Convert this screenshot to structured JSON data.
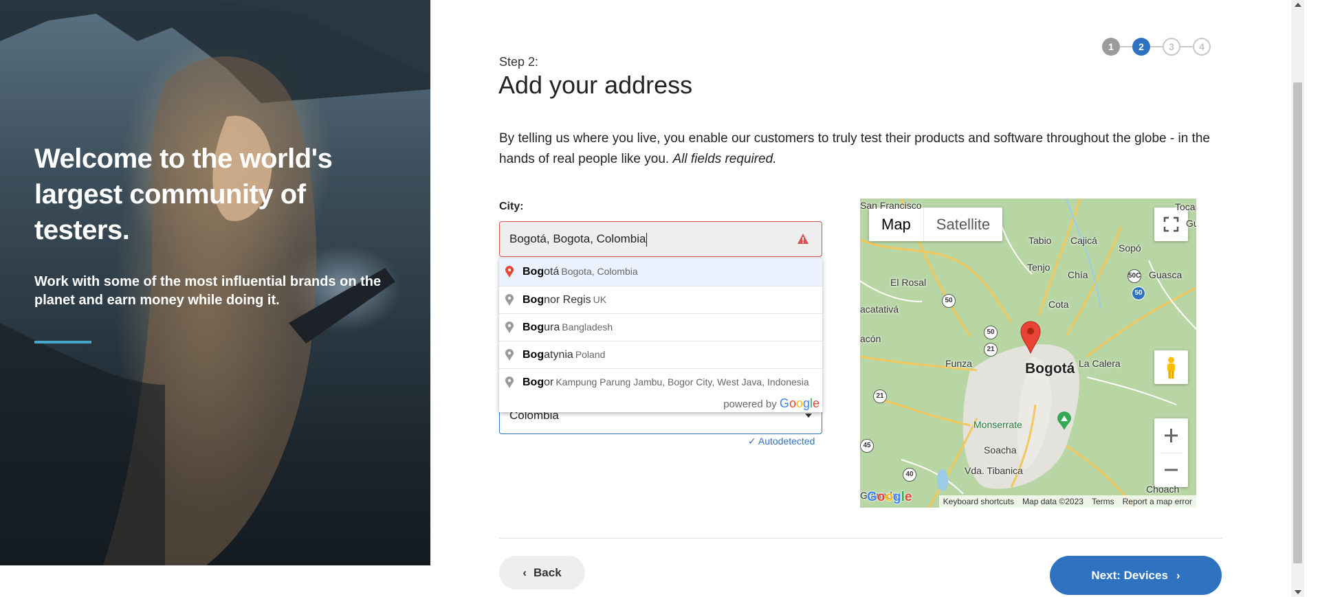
{
  "hero": {
    "title": "Welcome to the world's largest community of testers.",
    "subtitle": "Work with some of the most influential brands on the planet and earn money while doing it.",
    "accent_color": "#4aa6c8"
  },
  "stepper": {
    "steps": [
      "1",
      "2",
      "3",
      "4"
    ],
    "current": 2,
    "active_color": "#2f73c0"
  },
  "page": {
    "step_label": "Step 2:",
    "title": "Add your address",
    "intro": "By telling us where you live, you enable our customers to truly test their products and software throughout the globe - in the hands of real people like you.",
    "intro_emphasis": "All fields required."
  },
  "city": {
    "label": "City:",
    "value": "Bogotá, Bogota, Colombia"
  },
  "autocomplete": {
    "items": [
      {
        "match": "Bog",
        "rest": "otá",
        "secondary": "Bogota, Colombia",
        "selected": true
      },
      {
        "match": "Bog",
        "rest": "nor Regis",
        "secondary": "UK"
      },
      {
        "match": "Bog",
        "rest": "ura",
        "secondary": "Bangladesh"
      },
      {
        "match": "Bog",
        "rest": "atynia",
        "secondary": "Poland"
      },
      {
        "match": "Bog",
        "rest": "or",
        "secondary": "Kampung Parung Jambu, Bogor City, West Java, Indonesia"
      }
    ],
    "powered_by": "powered by",
    "google": "Google"
  },
  "country": {
    "value": "Colombia",
    "autodetected": "Autodetected"
  },
  "map": {
    "type_map": "Map",
    "type_satellite": "Satellite",
    "main_city": "Bogotá",
    "labels": [
      "San Francisco",
      "Tabio",
      "Cajicá",
      "Sopó",
      "Tocancipá",
      "Gua",
      "Tenjo",
      "Chía",
      "Guasca",
      "El Rosal",
      "Cota",
      "acatativá",
      "acón",
      "Funza",
      "La Calera",
      "Monserrate",
      "Soacha",
      "Vda. Tibanica",
      "Granada",
      "Choach"
    ],
    "roads": [
      "50",
      "50",
      "50C",
      "50",
      "21",
      "21",
      "40",
      "45"
    ],
    "footer": [
      "Keyboard shortcuts",
      "Map data ©2023",
      "Terms",
      "Report a map error"
    ],
    "google": "Google"
  },
  "buttons": {
    "back": "Back",
    "next": "Next: Devices"
  }
}
